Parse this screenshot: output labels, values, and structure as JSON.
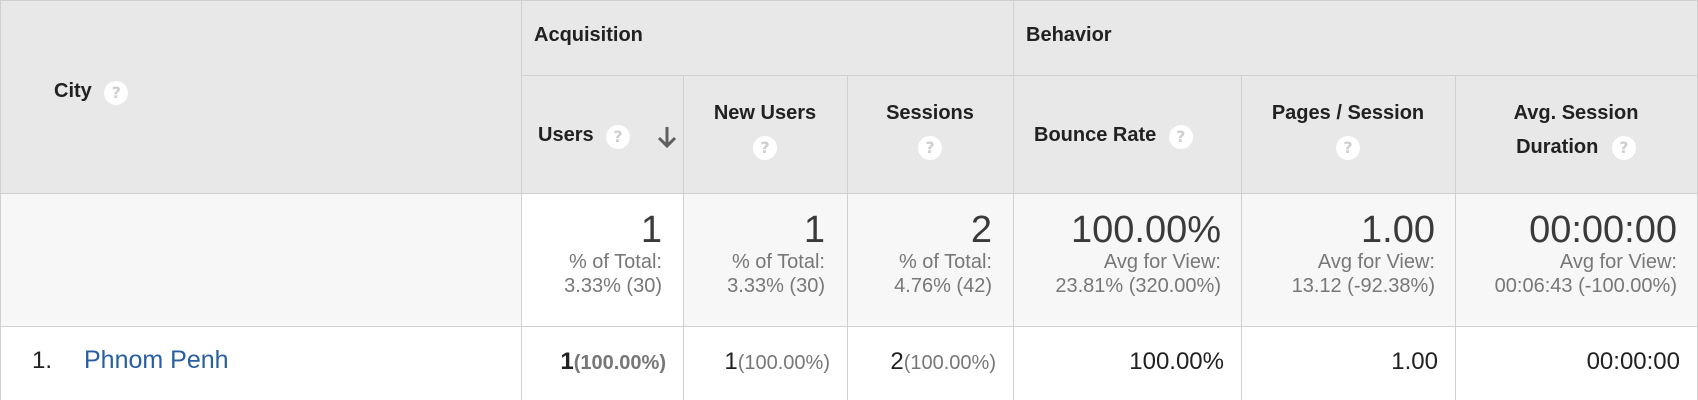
{
  "header": {
    "dimension_label": "City",
    "acquisition_label": "Acquisition",
    "behavior_label": "Behavior",
    "users_label": "Users",
    "new_users_label": "New Users",
    "sessions_label": "Sessions",
    "bounce_rate_label": "Bounce Rate",
    "pages_session_label": "Pages / Session",
    "avg_duration_label_1": "Avg. Session",
    "avg_duration_label_2": "Duration",
    "help_glyph": "?",
    "sort_direction": "descending"
  },
  "totals": {
    "users": {
      "value": "1",
      "line1": "% of Total:",
      "line2": "3.33% (30)"
    },
    "new_users": {
      "value": "1",
      "line1": "% of Total:",
      "line2": "3.33% (30)"
    },
    "sessions": {
      "value": "2",
      "line1": "% of Total:",
      "line2": "4.76% (42)"
    },
    "bounce_rate": {
      "value": "100.00%",
      "line1": "Avg for View:",
      "line2": "23.81% (320.00%)"
    },
    "pages_session": {
      "value": "1.00",
      "line1": "Avg for View:",
      "line2": "13.12 (-92.38%)"
    },
    "avg_duration": {
      "value": "00:00:00",
      "line1": "Avg for View:",
      "line2": "00:06:43 (-100.00%)"
    }
  },
  "rows": [
    {
      "index": "1.",
      "city": "Phnom Penh",
      "users": "1",
      "users_pct": "(100.00%)",
      "new_users": "1",
      "new_users_pct": "(100.00%)",
      "sessions": "2",
      "sessions_pct": "(100.00%)",
      "bounce_rate": "100.00%",
      "pages_session": "1.00",
      "avg_duration": "00:00:00"
    }
  ],
  "colors": {
    "header_bg": "#e8e8e8",
    "totals_bg": "#f7f7f7",
    "link": "#2a5ea3",
    "border": "#d0d0d0"
  }
}
